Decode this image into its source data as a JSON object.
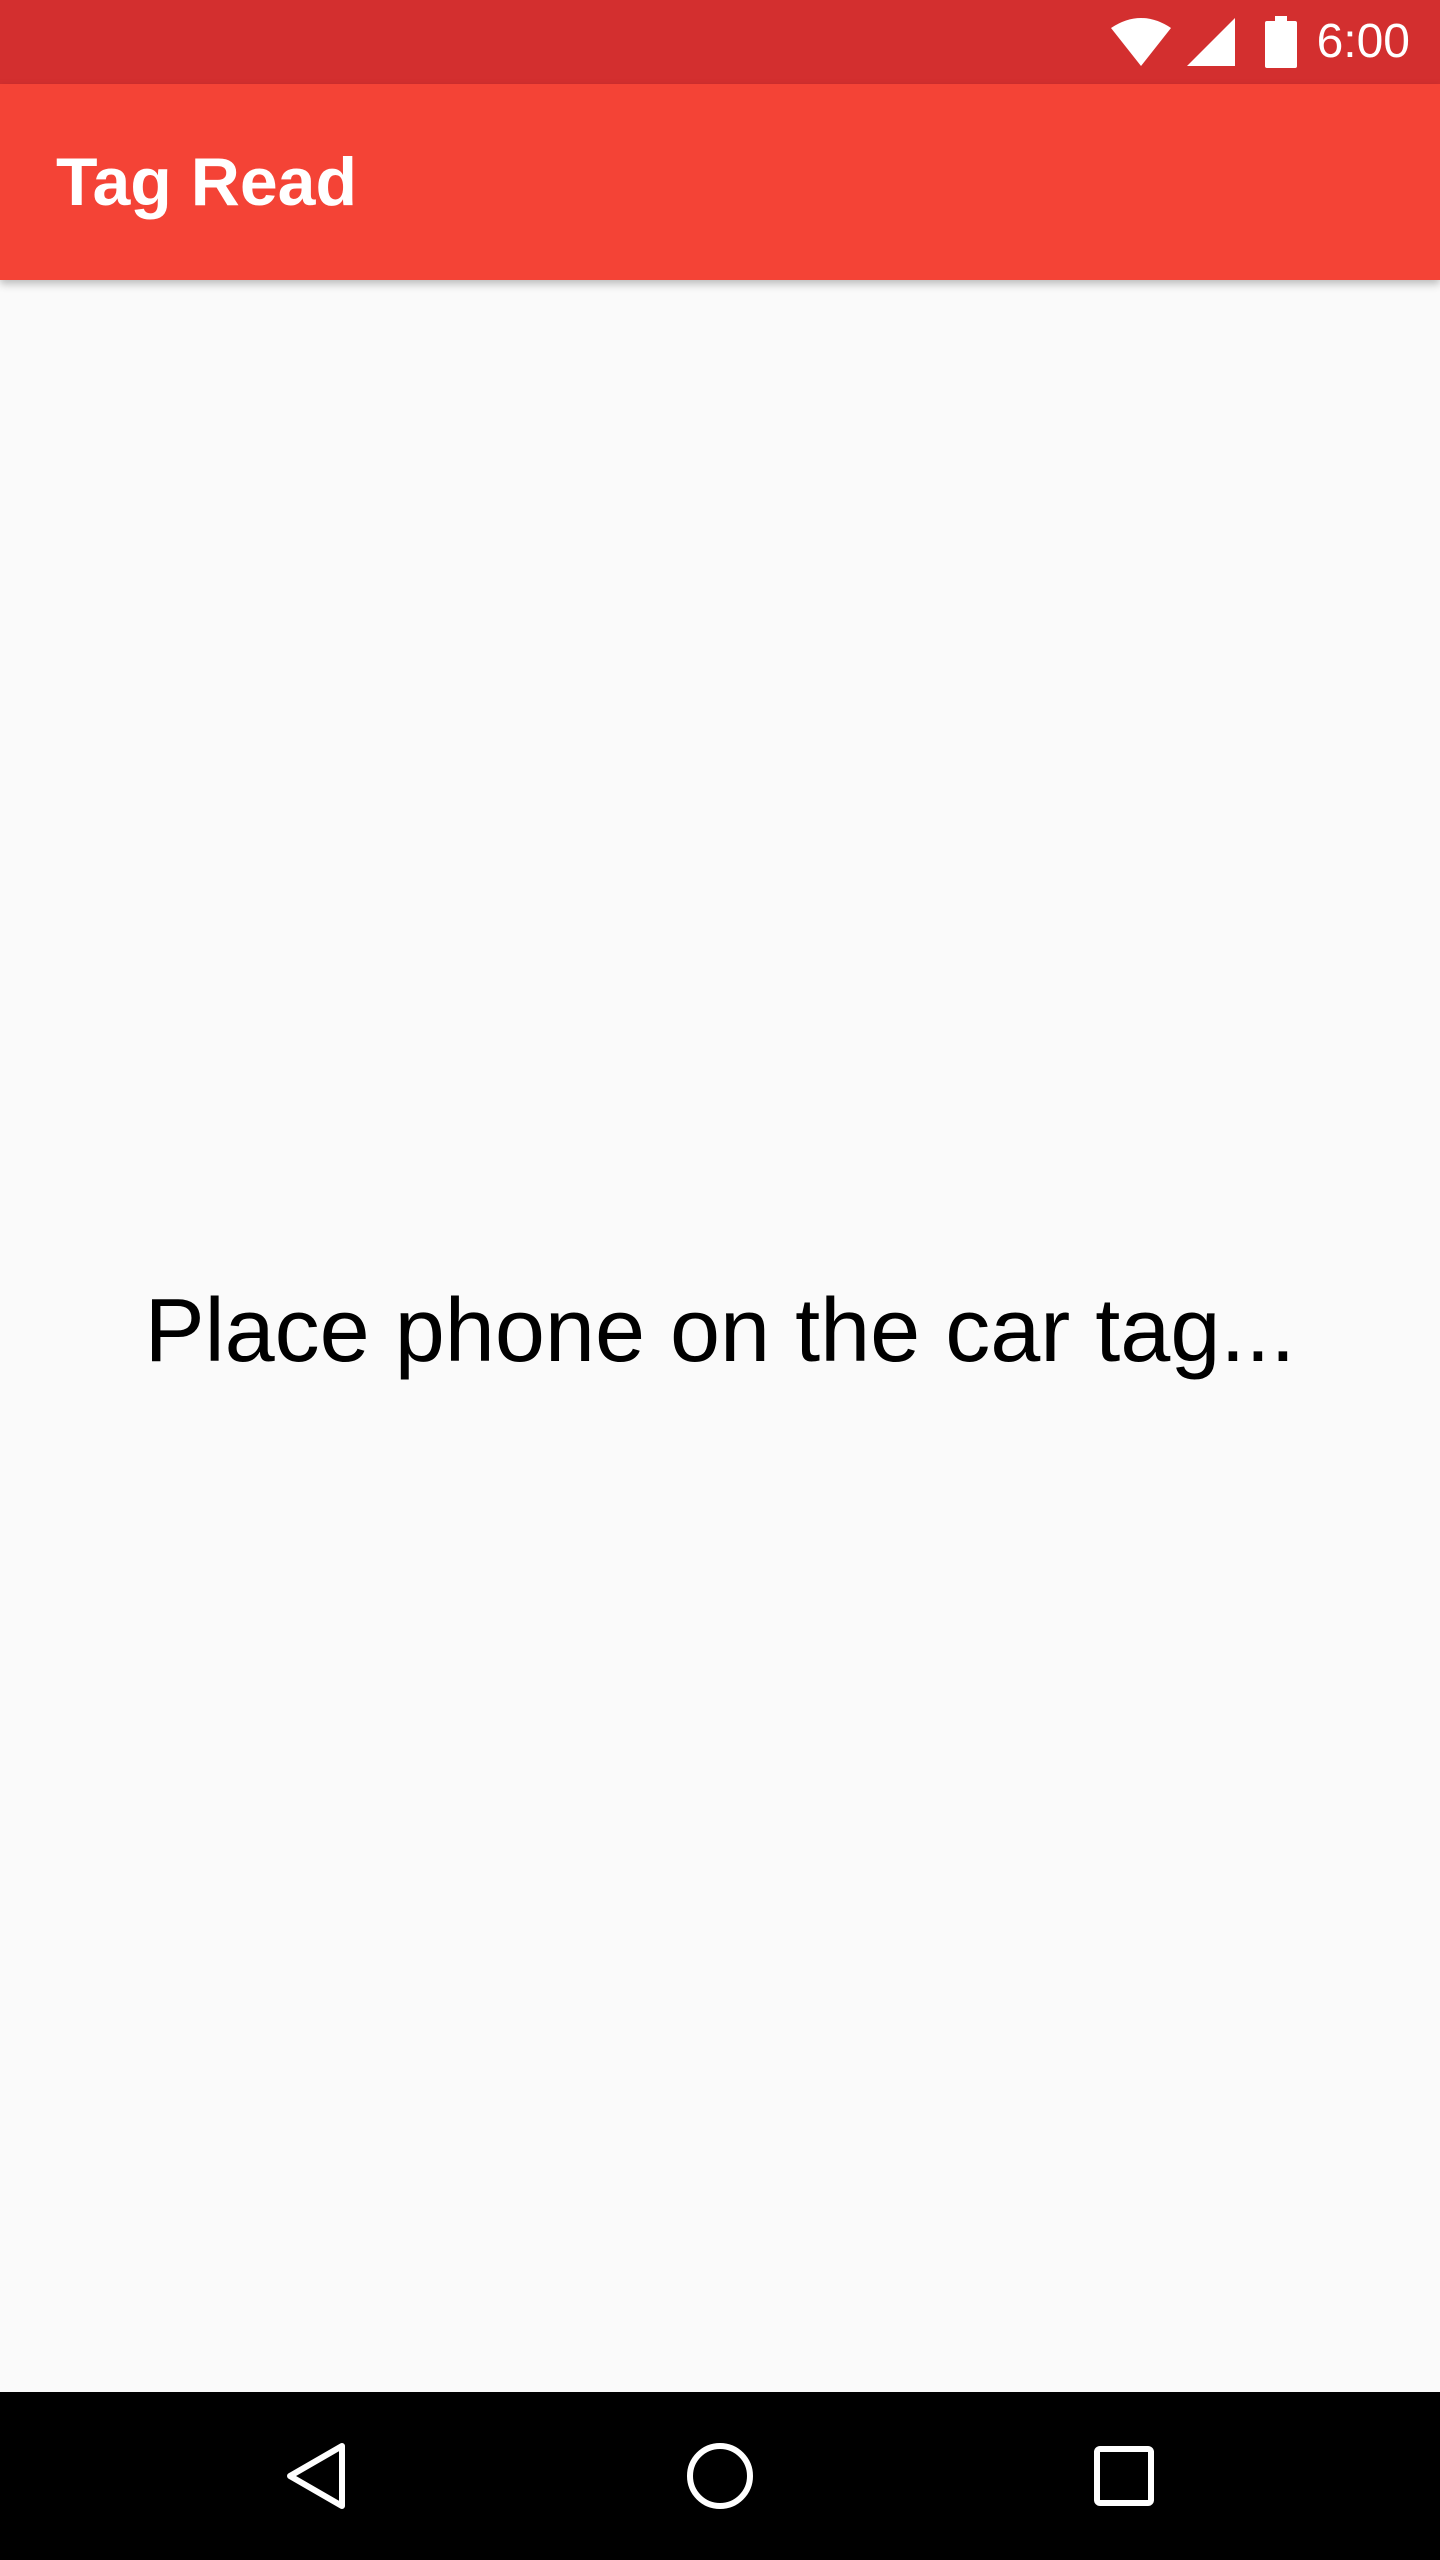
{
  "status_bar": {
    "time": "6:00",
    "icons": [
      "wifi-icon",
      "cellular-signal-icon",
      "battery-icon"
    ],
    "background_color": "#d32f2f"
  },
  "app_bar": {
    "title": "Tag Read",
    "background_color": "#f44336"
  },
  "content": {
    "message": "Place phone on the car tag..."
  },
  "nav_bar": {
    "buttons": [
      "back-icon",
      "home-icon",
      "recents-icon"
    ]
  }
}
